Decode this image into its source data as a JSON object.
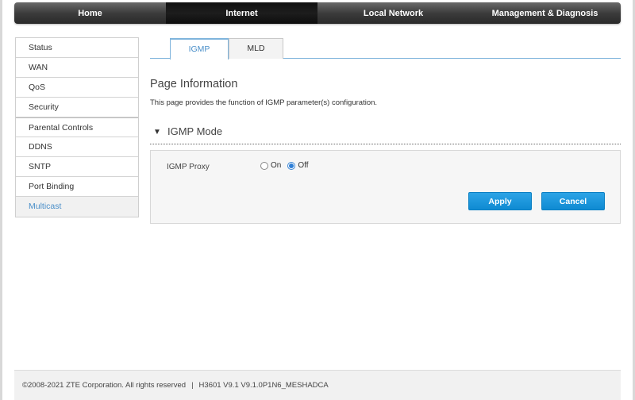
{
  "topnav": {
    "items": [
      {
        "label": "Home",
        "active": false
      },
      {
        "label": "Internet",
        "active": true
      },
      {
        "label": "Local Network",
        "active": false
      },
      {
        "label": "Management & Diagnosis",
        "active": false
      }
    ]
  },
  "sidebar": {
    "items": [
      {
        "label": "Status"
      },
      {
        "label": "WAN"
      },
      {
        "label": "QoS"
      },
      {
        "label": "Security"
      },
      {
        "label": "Parental Controls"
      },
      {
        "label": "DDNS"
      },
      {
        "label": "SNTP"
      },
      {
        "label": "Port Binding"
      },
      {
        "label": "Multicast",
        "active": true
      }
    ]
  },
  "tabs": {
    "igmp": "IGMP",
    "mld": "MLD"
  },
  "page": {
    "title": "Page Information",
    "description": "This page provides the function of IGMP parameter(s) configuration."
  },
  "section": {
    "title": "IGMP Mode",
    "arrow_icon": "triangle-down-icon"
  },
  "form": {
    "igmp_proxy_label": "IGMP Proxy",
    "option_on": "On",
    "option_off": "Off",
    "selected": "Off",
    "apply_label": "Apply",
    "cancel_label": "Cancel"
  },
  "footer": {
    "copyright": "©2008-2021 ZTE Corporation. All rights reserved",
    "separator": "|",
    "version": "H3601 V9.1 V9.1.0P1N6_MESHADCA"
  },
  "colors": {
    "accent": "#4a8fc9",
    "button": "#1a96dc",
    "nav_dark": "#2a2a2a"
  }
}
